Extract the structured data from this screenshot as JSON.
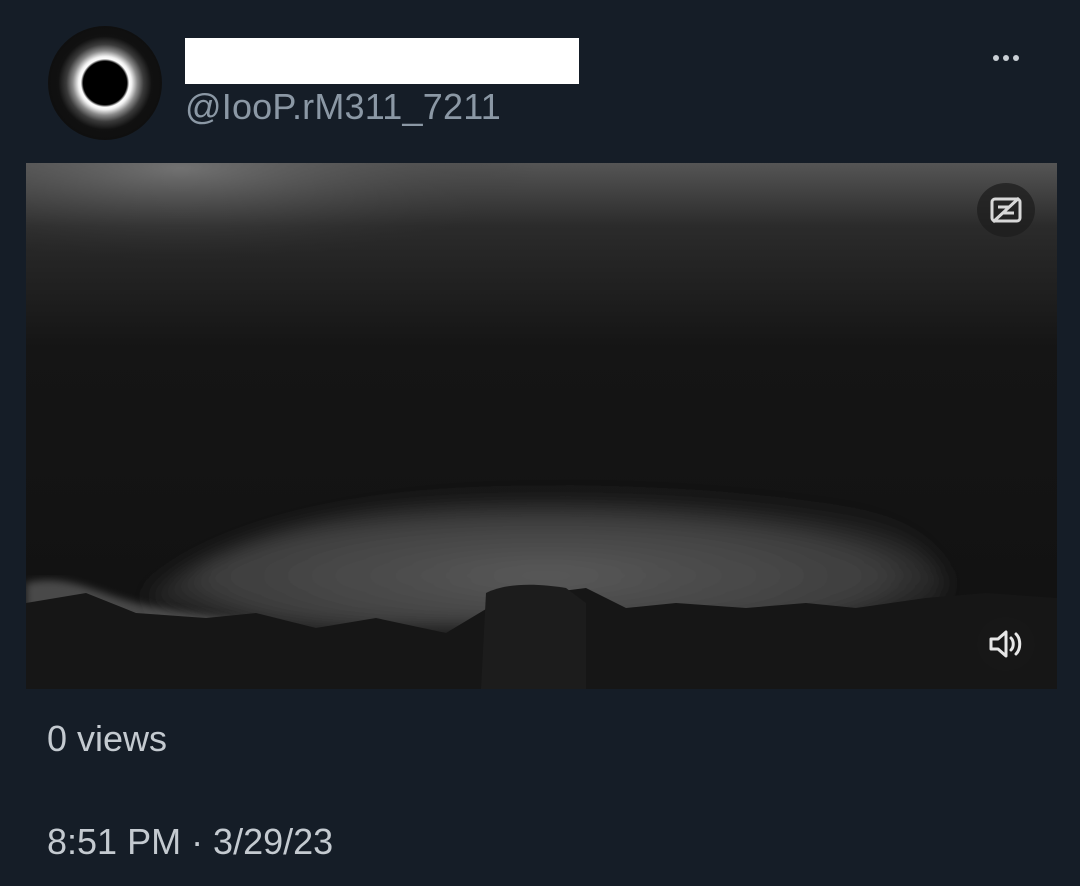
{
  "tweet": {
    "handle": "@IooP.rM311_7211",
    "views_text": "0 views",
    "timestamp": "8:51 PM · 3/29/23"
  },
  "icons": {
    "more": "more-horizontal-icon",
    "gif_toggle": "crossed-out-subtitles-icon",
    "mute": "speaker-volume-icon"
  },
  "colors": {
    "background": "#151d27",
    "secondary_text": "#8b98a5",
    "primary_text": "#c4cad0"
  }
}
